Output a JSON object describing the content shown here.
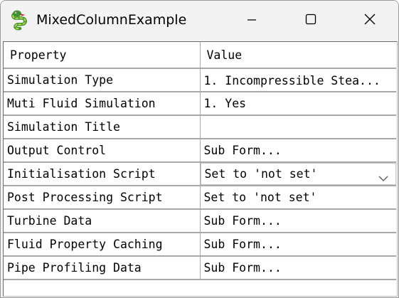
{
  "window": {
    "title": "MixedColumnExample",
    "icon": "python-snake-icon",
    "controls": [
      "minimize-icon",
      "maximize-icon",
      "close-icon"
    ]
  },
  "grid": {
    "headers": [
      "Property",
      "Value"
    ],
    "rows": [
      {
        "property": "Simulation Type",
        "value": "1. Incompressible Stea..."
      },
      {
        "property": "Muti Fluid Simulation",
        "value": "1. Yes"
      },
      {
        "property": "Simulation Title",
        "value": ""
      },
      {
        "property": "Output Control",
        "value": "Sub Form..."
      },
      {
        "property": "Initialisation Script",
        "value": "Set to 'not set'",
        "editor": "dropdown"
      },
      {
        "property": "Post Processing Script",
        "value": "Set to 'not set'"
      },
      {
        "property": "Turbine Data",
        "value": "Sub Form..."
      },
      {
        "property": "Fluid Property Caching",
        "value": "Sub Form..."
      },
      {
        "property": "Pipe Profiling Data",
        "value": "Sub Form..."
      }
    ]
  },
  "colors": {
    "titlebar_bg": "#f3f3f3",
    "grid_line": "#a8a8a8",
    "text": "#000000"
  }
}
